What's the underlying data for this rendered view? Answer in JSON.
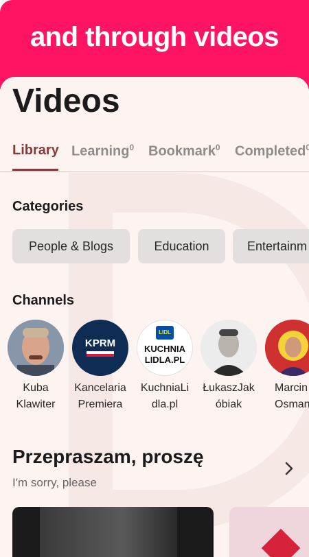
{
  "banner": {
    "title": "and through videos"
  },
  "page": {
    "title": "Videos"
  },
  "tabs": [
    {
      "label": "Library",
      "count": ""
    },
    {
      "label": "Learning",
      "count": "0"
    },
    {
      "label": "Bookmark",
      "count": "0"
    },
    {
      "label": "Completed",
      "count": "0"
    }
  ],
  "categories": {
    "title": "Categories",
    "items": [
      "People & Blogs",
      "Education",
      "Entertainm"
    ]
  },
  "channels": {
    "title": "Channels",
    "items": [
      {
        "name_line1": "Kuba",
        "name_line2": "Klawiter"
      },
      {
        "name_line1": "Kancelaria",
        "name_line2": "Premiera",
        "logo_text": "KPRM"
      },
      {
        "name_line1": "KuchniaLi",
        "name_line2": "dla.pl",
        "logo_top": "LIDL",
        "logo_line1": "KUCHNIA",
        "logo_line2": "LIDLA.PL"
      },
      {
        "name_line1": "ŁukaszJak",
        "name_line2": "óbiak"
      },
      {
        "name_line1": "Marcin",
        "name_line2": "Osman"
      }
    ]
  },
  "recommendation": {
    "title": "Przepraszam, proszę",
    "subtitle": "I'm sorry, please"
  },
  "colors": {
    "brand": "#ff1464",
    "accent": "#8a3a3a",
    "card_bg": "#fdf3f1"
  }
}
